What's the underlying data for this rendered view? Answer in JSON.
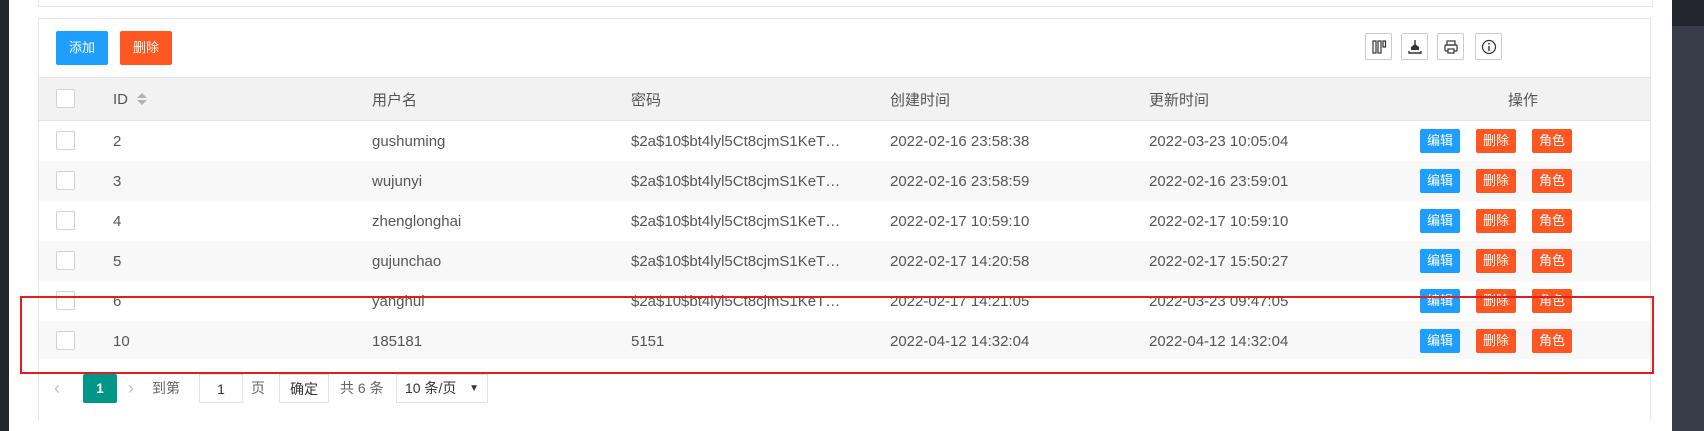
{
  "toolbar": {
    "add_label": "添加",
    "delete_label": "删除"
  },
  "icons": {
    "filter_columns": "columns-icon",
    "export": "export-icon",
    "print": "print-icon",
    "info": "info-icon"
  },
  "table": {
    "headers": {
      "id": "ID",
      "username": "用户名",
      "password": "密码",
      "created": "创建时间",
      "updated": "更新时间",
      "actions": "操作"
    },
    "rows": [
      {
        "id": "2",
        "username": "gushuming",
        "password": "$2a$10$bt4lyl5Ct8cjmS1KeT…",
        "created": "2022-02-16 23:58:38",
        "updated": "2022-03-23 10:05:04"
      },
      {
        "id": "3",
        "username": "wujunyi",
        "password": "$2a$10$bt4lyl5Ct8cjmS1KeT…",
        "created": "2022-02-16 23:58:59",
        "updated": "2022-02-16 23:59:01"
      },
      {
        "id": "4",
        "username": "zhenglonghai",
        "password": "$2a$10$bt4lyl5Ct8cjmS1KeT…",
        "created": "2022-02-17 10:59:10",
        "updated": "2022-02-17 10:59:10"
      },
      {
        "id": "5",
        "username": "gujunchao",
        "password": "$2a$10$bt4lyl5Ct8cjmS1KeT…",
        "created": "2022-02-17 14:20:58",
        "updated": "2022-02-17 15:50:27"
      },
      {
        "id": "6",
        "username": "yanghui",
        "password": "$2a$10$bt4lyl5Ct8cjmS1KeT…",
        "created": "2022-02-17 14:21:05",
        "updated": "2022-03-23 09:47:05"
      },
      {
        "id": "10",
        "username": "185181",
        "password": "5151",
        "created": "2022-04-12 14:32:04",
        "updated": "2022-04-12 14:32:04"
      }
    ],
    "row_actions": {
      "edit": "编辑",
      "delete": "删除",
      "role": "角色"
    }
  },
  "pagination": {
    "prev": "‹",
    "current_page": "1",
    "next": "›",
    "goto_label": "到第",
    "goto_value": "1",
    "page_unit": "页",
    "confirm": "确定",
    "total": "共 6 条",
    "page_size": "10 条/页"
  },
  "colors": {
    "primary": "#1e9fff",
    "danger": "#ff5722",
    "pager_active": "#009688",
    "highlight": "#e01e1e"
  }
}
